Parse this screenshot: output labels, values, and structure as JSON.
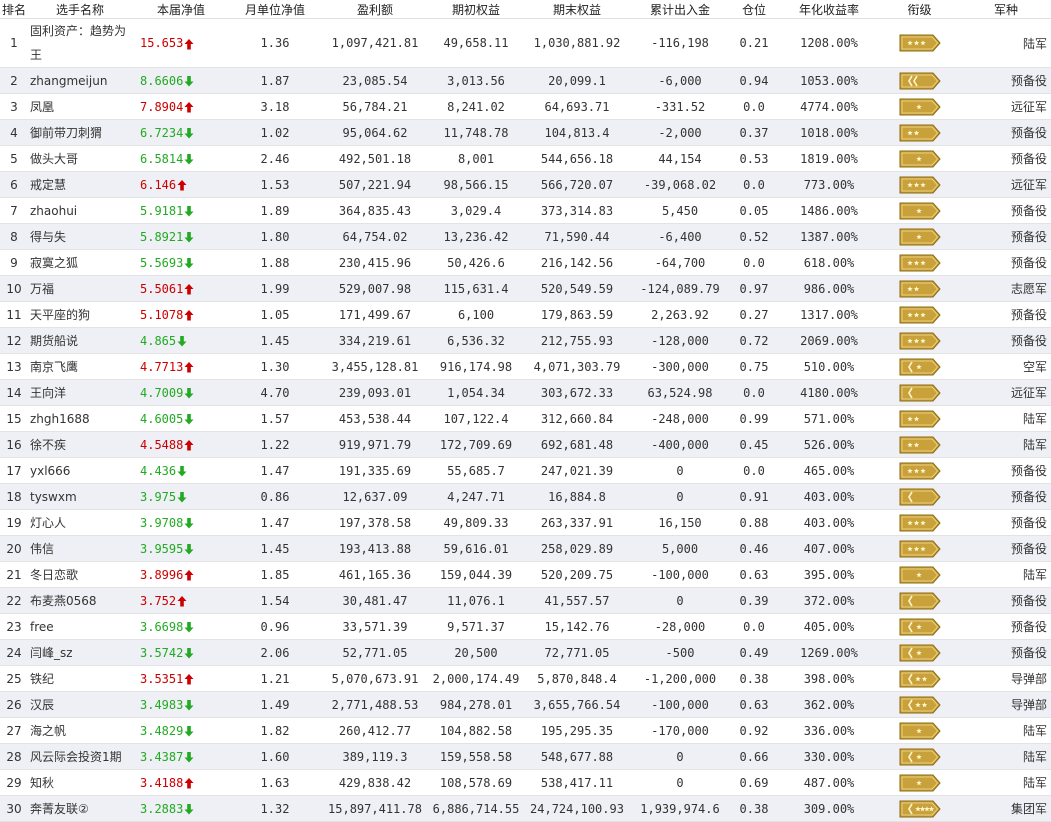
{
  "headers": [
    "排名",
    "选手名称",
    "本届净值",
    "月单位净值",
    "盈利额",
    "期初权益",
    "期末权益",
    "累计出入金",
    "仓位",
    "年化收益率",
    "衔级",
    "军种"
  ],
  "rows": [
    {
      "rank": "1",
      "name": "固利资产：趋势为王",
      "nav": "15.653",
      "trend": "up",
      "mnav": "1.36",
      "profit": "1,097,421.81",
      "start": "49,658.11",
      "end": "1,030,881.92",
      "flow": "-116,198",
      "pos": "0.21",
      "annual": "1208.00%",
      "rank_badge": "three-star",
      "corps": "陆军"
    },
    {
      "rank": "2",
      "name": "zhangmeijun",
      "nav": "8.6606",
      "trend": "down",
      "mnav": "1.87",
      "profit": "23,085.54",
      "start": "3,013.56",
      "end": "20,099.1",
      "flow": "-6,000",
      "pos": "0.94",
      "annual": "1053.00%",
      "rank_badge": "chevron-double",
      "corps": "预备役"
    },
    {
      "rank": "3",
      "name": "凤凰",
      "nav": "7.8904",
      "trend": "up",
      "mnav": "3.18",
      "profit": "56,784.21",
      "start": "8,241.02",
      "end": "64,693.71",
      "flow": "-331.52",
      "pos": "0.0",
      "annual": "4774.00%",
      "rank_badge": "one-star",
      "corps": "远征军"
    },
    {
      "rank": "4",
      "name": "御前带刀刺猬",
      "nav": "6.7234",
      "trend": "down",
      "mnav": "1.02",
      "profit": "95,064.62",
      "start": "11,748.78",
      "end": "104,813.4",
      "flow": "-2,000",
      "pos": "0.37",
      "annual": "1018.00%",
      "rank_badge": "two-star",
      "corps": "预备役"
    },
    {
      "rank": "5",
      "name": "做头大哥",
      "nav": "6.5814",
      "trend": "down",
      "mnav": "2.46",
      "profit": "492,501.18",
      "start": "8,001",
      "end": "544,656.18",
      "flow": "44,154",
      "pos": "0.53",
      "annual": "1819.00%",
      "rank_badge": "one-star",
      "corps": "预备役"
    },
    {
      "rank": "6",
      "name": "戒定慧",
      "nav": "6.146",
      "trend": "up",
      "mnav": "1.53",
      "profit": "507,221.94",
      "start": "98,566.15",
      "end": "566,720.07",
      "flow": "-39,068.02",
      "pos": "0.0",
      "annual": "773.00%",
      "rank_badge": "three-star",
      "corps": "远征军"
    },
    {
      "rank": "7",
      "name": "zhaohui",
      "nav": "5.9181",
      "trend": "down",
      "mnav": "1.89",
      "profit": "364,835.43",
      "start": "3,029.4",
      "end": "373,314.83",
      "flow": "5,450",
      "pos": "0.05",
      "annual": "1486.00%",
      "rank_badge": "one-star",
      "corps": "预备役"
    },
    {
      "rank": "8",
      "name": "得与失",
      "nav": "5.8921",
      "trend": "down",
      "mnav": "1.80",
      "profit": "64,754.02",
      "start": "13,236.42",
      "end": "71,590.44",
      "flow": "-6,400",
      "pos": "0.52",
      "annual": "1387.00%",
      "rank_badge": "one-star",
      "corps": "预备役"
    },
    {
      "rank": "9",
      "name": "寂寞之狐",
      "nav": "5.5693",
      "trend": "down",
      "mnav": "1.88",
      "profit": "230,415.96",
      "start": "50,426.6",
      "end": "216,142.56",
      "flow": "-64,700",
      "pos": "0.0",
      "annual": "618.00%",
      "rank_badge": "three-star",
      "corps": "预备役"
    },
    {
      "rank": "10",
      "name": "万福",
      "nav": "5.5061",
      "trend": "up",
      "mnav": "1.99",
      "profit": "529,007.98",
      "start": "115,631.4",
      "end": "520,549.59",
      "flow": "-124,089.79",
      "pos": "0.97",
      "annual": "986.00%",
      "rank_badge": "two-star",
      "corps": "志愿军"
    },
    {
      "rank": "11",
      "name": "天平座的狗",
      "nav": "5.1078",
      "trend": "up",
      "mnav": "1.05",
      "profit": "171,499.67",
      "start": "6,100",
      "end": "179,863.59",
      "flow": "2,263.92",
      "pos": "0.27",
      "annual": "1317.00%",
      "rank_badge": "three-star",
      "corps": "预备役"
    },
    {
      "rank": "12",
      "name": "期货船说",
      "nav": "4.865",
      "trend": "down",
      "mnav": "1.45",
      "profit": "334,219.61",
      "start": "6,536.32",
      "end": "212,755.93",
      "flow": "-128,000",
      "pos": "0.72",
      "annual": "2069.00%",
      "rank_badge": "three-star",
      "corps": "预备役"
    },
    {
      "rank": "13",
      "name": "南京飞鹰",
      "nav": "4.7713",
      "trend": "up",
      "mnav": "1.30",
      "profit": "3,455,128.81",
      "start": "916,174.98",
      "end": "4,071,303.79",
      "flow": "-300,000",
      "pos": "0.75",
      "annual": "510.00%",
      "rank_badge": "chevron-star",
      "corps": "空军"
    },
    {
      "rank": "14",
      "name": "王向洋",
      "nav": "4.7009",
      "trend": "down",
      "mnav": "4.70",
      "profit": "239,093.01",
      "start": "1,054.34",
      "end": "303,672.33",
      "flow": "63,524.98",
      "pos": "0.0",
      "annual": "4180.00%",
      "rank_badge": "chevron",
      "corps": "远征军"
    },
    {
      "rank": "15",
      "name": "zhgh1688",
      "nav": "4.6005",
      "trend": "down",
      "mnav": "1.57",
      "profit": "453,538.44",
      "start": "107,122.4",
      "end": "312,660.84",
      "flow": "-248,000",
      "pos": "0.99",
      "annual": "571.00%",
      "rank_badge": "two-star",
      "corps": "陆军"
    },
    {
      "rank": "16",
      "name": "徐不疾",
      "nav": "4.5488",
      "trend": "up",
      "mnav": "1.22",
      "profit": "919,971.79",
      "start": "172,709.69",
      "end": "692,681.48",
      "flow": "-400,000",
      "pos": "0.45",
      "annual": "526.00%",
      "rank_badge": "two-star",
      "corps": "陆军"
    },
    {
      "rank": "17",
      "name": "yxl666",
      "nav": "4.436",
      "trend": "down",
      "mnav": "1.47",
      "profit": "191,335.69",
      "start": "55,685.7",
      "end": "247,021.39",
      "flow": "0",
      "pos": "0.0",
      "annual": "465.00%",
      "rank_badge": "three-star",
      "corps": "预备役"
    },
    {
      "rank": "18",
      "name": "tyswxm",
      "nav": "3.975",
      "trend": "down",
      "mnav": "0.86",
      "profit": "12,637.09",
      "start": "4,247.71",
      "end": "16,884.8",
      "flow": "0",
      "pos": "0.91",
      "annual": "403.00%",
      "rank_badge": "chevron",
      "corps": "预备役"
    },
    {
      "rank": "19",
      "name": "灯心人",
      "nav": "3.9708",
      "trend": "down",
      "mnav": "1.47",
      "profit": "197,378.58",
      "start": "49,809.33",
      "end": "263,337.91",
      "flow": "16,150",
      "pos": "0.88",
      "annual": "403.00%",
      "rank_badge": "three-star",
      "corps": "预备役"
    },
    {
      "rank": "20",
      "name": "伟信",
      "nav": "3.9595",
      "trend": "down",
      "mnav": "1.45",
      "profit": "193,413.88",
      "start": "59,616.01",
      "end": "258,029.89",
      "flow": "5,000",
      "pos": "0.46",
      "annual": "407.00%",
      "rank_badge": "three-star",
      "corps": "预备役"
    },
    {
      "rank": "21",
      "name": "冬日恋歌",
      "nav": "3.8996",
      "trend": "up",
      "mnav": "1.85",
      "profit": "461,165.36",
      "start": "159,044.39",
      "end": "520,209.75",
      "flow": "-100,000",
      "pos": "0.63",
      "annual": "395.00%",
      "rank_badge": "one-star",
      "corps": "陆军"
    },
    {
      "rank": "22",
      "name": "布麦燕0568",
      "nav": "3.752",
      "trend": "up",
      "mnav": "1.54",
      "profit": "30,481.47",
      "start": "11,076.1",
      "end": "41,557.57",
      "flow": "0",
      "pos": "0.39",
      "annual": "372.00%",
      "rank_badge": "chevron",
      "corps": "预备役"
    },
    {
      "rank": "23",
      "name": "free",
      "nav": "3.6698",
      "trend": "down",
      "mnav": "0.96",
      "profit": "33,571.39",
      "start": "9,571.37",
      "end": "15,142.76",
      "flow": "-28,000",
      "pos": "0.0",
      "annual": "405.00%",
      "rank_badge": "chevron-star",
      "corps": "预备役"
    },
    {
      "rank": "24",
      "name": "闫峰_sz",
      "nav": "3.5742",
      "trend": "down",
      "mnav": "2.06",
      "profit": "52,771.05",
      "start": "20,500",
      "end": "72,771.05",
      "flow": "-500",
      "pos": "0.49",
      "annual": "1269.00%",
      "rank_badge": "chevron-star",
      "corps": "预备役"
    },
    {
      "rank": "25",
      "name": "铁纪",
      "nav": "3.5351",
      "trend": "up",
      "mnav": "1.21",
      "profit": "5,070,673.91",
      "start": "2,000,174.49",
      "end": "5,870,848.4",
      "flow": "-1,200,000",
      "pos": "0.38",
      "annual": "398.00%",
      "rank_badge": "chevron-two-star",
      "corps": "导弹部"
    },
    {
      "rank": "26",
      "name": "汉辰",
      "nav": "3.4983",
      "trend": "down",
      "mnav": "1.49",
      "profit": "2,771,488.53",
      "start": "984,278.01",
      "end": "3,655,766.54",
      "flow": "-100,000",
      "pos": "0.63",
      "annual": "362.00%",
      "rank_badge": "chevron-two-star",
      "corps": "导弹部"
    },
    {
      "rank": "27",
      "name": "海之帆",
      "nav": "3.4829",
      "trend": "down",
      "mnav": "1.82",
      "profit": "260,412.77",
      "start": "104,882.58",
      "end": "195,295.35",
      "flow": "-170,000",
      "pos": "0.92",
      "annual": "336.00%",
      "rank_badge": "one-star",
      "corps": "陆军"
    },
    {
      "rank": "28",
      "name": "风云际会投资1期",
      "nav": "3.4387",
      "trend": "down",
      "mnav": "1.60",
      "profit": "389,119.3",
      "start": "159,558.58",
      "end": "548,677.88",
      "flow": "0",
      "pos": "0.66",
      "annual": "330.00%",
      "rank_badge": "chevron-star",
      "corps": "陆军"
    },
    {
      "rank": "29",
      "name": "知秋",
      "nav": "3.4188",
      "trend": "up",
      "mnav": "1.63",
      "profit": "429,838.42",
      "start": "108,578.69",
      "end": "538,417.11",
      "flow": "0",
      "pos": "0.69",
      "annual": "487.00%",
      "rank_badge": "one-star",
      "corps": "陆军"
    },
    {
      "rank": "30",
      "name": "奔菁友联②",
      "nav": "3.2883",
      "trend": "down",
      "mnav": "1.32",
      "profit": "15,897,411.78",
      "start": "6,886,714.55",
      "end": "24,724,100.93",
      "flow": "1,939,974.6",
      "pos": "0.38",
      "annual": "309.00%",
      "rank_badge": "chevron-four-star",
      "corps": "集团军"
    }
  ],
  "colors": {
    "up": "#cc0000",
    "down": "#22aa22",
    "badge": "#c9a13a",
    "badge_dark": "#8a6a14"
  }
}
